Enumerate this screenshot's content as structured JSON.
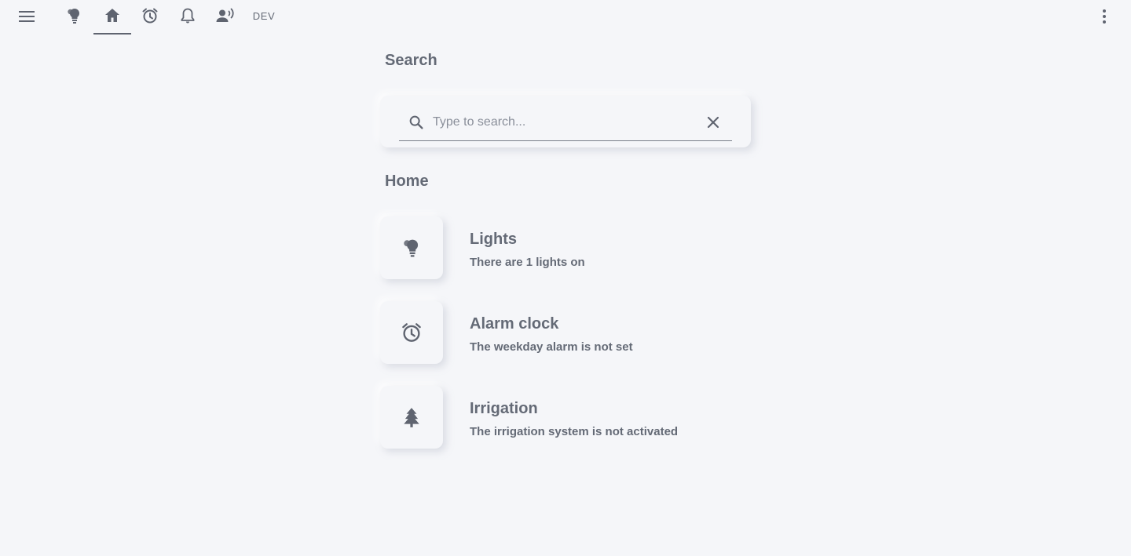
{
  "topbar": {
    "tabs": [
      {
        "icon": "lightbulb-icon"
      },
      {
        "icon": "home-icon",
        "active": true
      },
      {
        "icon": "alarm-clock-icon"
      },
      {
        "icon": "bell-icon"
      },
      {
        "icon": "person-voice-icon"
      }
    ],
    "dev_label": "DEV"
  },
  "search": {
    "heading": "Search",
    "placeholder": "Type to search...",
    "value": ""
  },
  "home": {
    "heading": "Home",
    "items": [
      {
        "title": "Lights",
        "subtitle": "There are 1 lights on",
        "icon": "lightbulb-icon"
      },
      {
        "title": "Alarm clock",
        "subtitle": "The weekday alarm is not set",
        "icon": "alarm-clock-icon"
      },
      {
        "title": "Irrigation",
        "subtitle": "The irrigation system is not activated",
        "icon": "tree-icon"
      }
    ]
  },
  "colors": {
    "background": "#f5f6f9",
    "text": "#646a76",
    "icon": "#5f6470"
  }
}
